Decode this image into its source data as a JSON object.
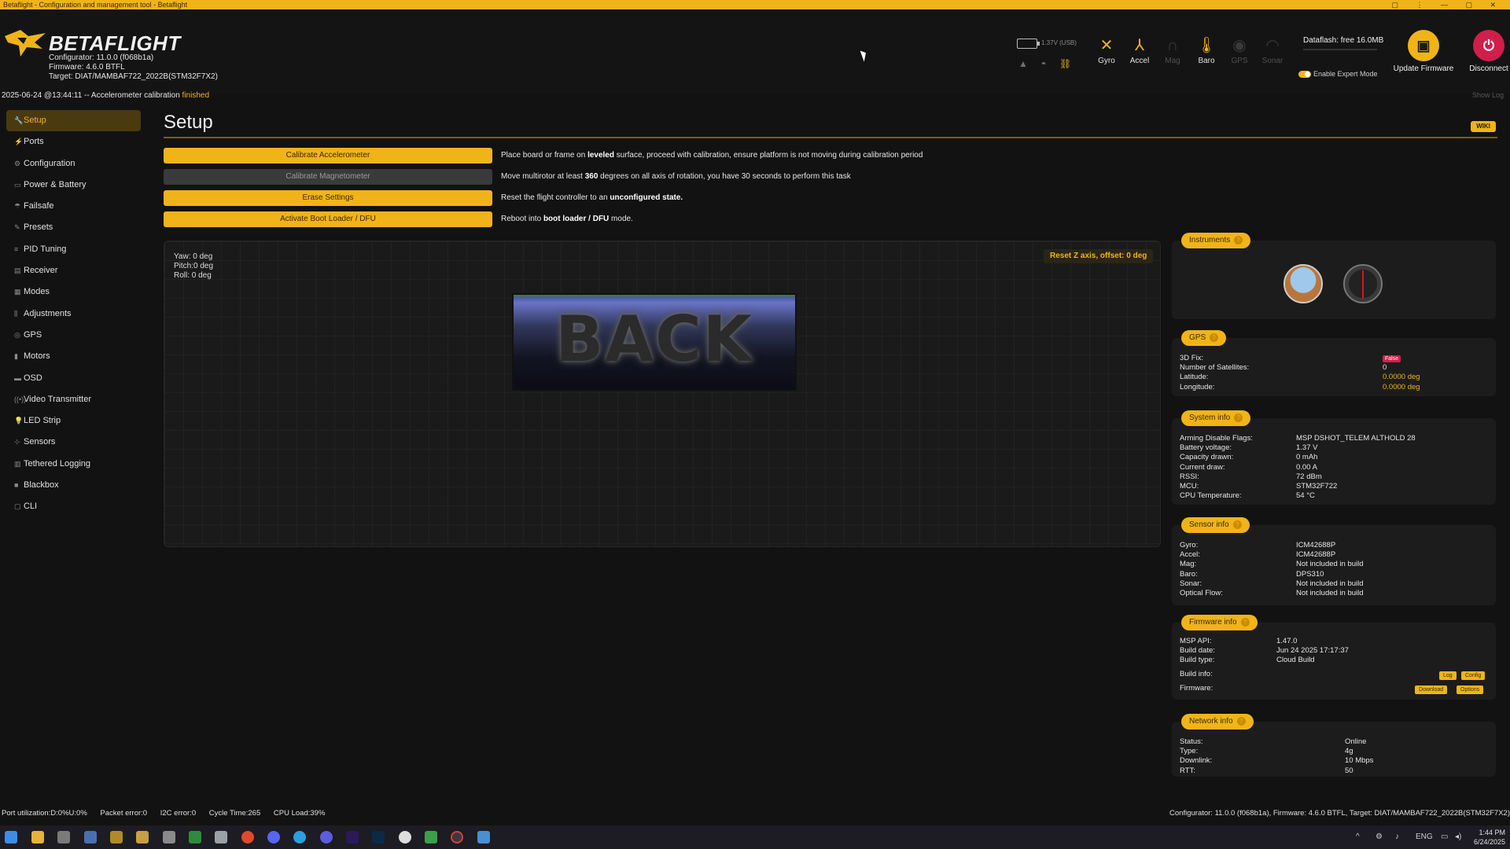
{
  "window": {
    "title": "Betaflight - Configuration and management tool - Betaflight"
  },
  "header": {
    "brand": "BETAFLIGHT",
    "configurator": "Configurator: 11.0.0 (f068b1a)",
    "firmware": "Firmware: 4.6.0 BTFL",
    "target": "Target: DIAT/MAMBAF722_2022B(STM32F7X2)",
    "log_prefix": "2025-06-24 @13:44:11 -- Accelerometer calibration",
    "log_status": "finished",
    "battery": "1.37V (USB)",
    "sensors": [
      {
        "label": "Gyro",
        "active": true,
        "icon": "gyro-icon"
      },
      {
        "label": "Accel",
        "active": true,
        "icon": "accel-icon"
      },
      {
        "label": "Mag",
        "active": false,
        "icon": "mag-icon"
      },
      {
        "label": "Baro",
        "active": true,
        "icon": "baro-icon"
      },
      {
        "label": "GPS",
        "active": false,
        "icon": "gps-icon"
      },
      {
        "label": "Sonar",
        "active": false,
        "icon": "sonar-icon"
      }
    ],
    "dataflash": "Dataflash: free 16.0MB",
    "expert_mode": "Enable Expert Mode",
    "update_firmware": "Update Firmware",
    "disconnect": "Disconnect",
    "show_log": "Show Log"
  },
  "sidebar": {
    "items": [
      {
        "label": "Setup",
        "icon": "wrench-icon"
      },
      {
        "label": "Ports",
        "icon": "plug-icon"
      },
      {
        "label": "Configuration",
        "icon": "gear-icon"
      },
      {
        "label": "Power & Battery",
        "icon": "battery-icon"
      },
      {
        "label": "Failsafe",
        "icon": "failsafe-icon"
      },
      {
        "label": "Presets",
        "icon": "presets-icon"
      },
      {
        "label": "PID Tuning",
        "icon": "pid-icon"
      },
      {
        "label": "Receiver",
        "icon": "receiver-icon"
      },
      {
        "label": "Modes",
        "icon": "modes-icon"
      },
      {
        "label": "Adjustments",
        "icon": "adjustments-icon"
      },
      {
        "label": "GPS",
        "icon": "gps-icon"
      },
      {
        "label": "Motors",
        "icon": "motor-icon"
      },
      {
        "label": "OSD",
        "icon": "osd-icon"
      },
      {
        "label": "Video Transmitter",
        "icon": "vtx-icon"
      },
      {
        "label": "LED Strip",
        "icon": "led-icon"
      },
      {
        "label": "Sensors",
        "icon": "sensors-icon"
      },
      {
        "label": "Tethered Logging",
        "icon": "tethered-icon"
      },
      {
        "label": "Blackbox",
        "icon": "blackbox-icon"
      },
      {
        "label": "CLI",
        "icon": "cli-icon"
      }
    ]
  },
  "setup": {
    "title": "Setup",
    "wiki": "WIKI",
    "actions": [
      {
        "button": "Calibrate Accelerometer",
        "desc_parts": [
          "Place board or frame on ",
          "leveled",
          " surface, proceed with calibration, ensure platform is not moving during calibration period"
        ]
      },
      {
        "button": "Calibrate Magnetometer",
        "desc_parts": [
          "Move multirotor at least ",
          "360",
          " degrees on all axis of rotation, you have 30 seconds to perform this task"
        ]
      },
      {
        "button": "Erase Settings",
        "desc_parts": [
          "Reset the flight controller to an ",
          "unconfigured state.",
          ""
        ]
      },
      {
        "button": "Activate Boot Loader / DFU",
        "desc_parts": [
          "Reboot into ",
          "boot loader / DFU",
          " mode."
        ]
      }
    ],
    "attitude": {
      "yaw": "Yaw: 0 deg",
      "pitch": "Pitch:0 deg",
      "roll": "Roll:  0 deg"
    },
    "reset_z": "Reset Z axis, offset: 0 deg",
    "model_text": "BACK"
  },
  "instruments": {
    "title": "Instruments"
  },
  "gps": {
    "title": "GPS",
    "rows": [
      {
        "k": "3D Fix:",
        "v": "False"
      },
      {
        "k": "Number of Satellites:",
        "v": "0"
      },
      {
        "k": "Latitude:",
        "v": "0.0000 deg"
      },
      {
        "k": "Longitude:",
        "v": "0.0000 deg"
      }
    ]
  },
  "system": {
    "title": "System info",
    "rows": [
      {
        "k": "Arming Disable Flags:",
        "v": "MSP  DSHOT_TELEM  ALTHOLD  28"
      },
      {
        "k": "Battery voltage:",
        "v": "1.37 V"
      },
      {
        "k": "Capacity drawn:",
        "v": "0 mAh"
      },
      {
        "k": "Current draw:",
        "v": "0.00 A"
      },
      {
        "k": "RSSI:",
        "v": "72 dBm"
      },
      {
        "k": "MCU:",
        "v": "STM32F722"
      },
      {
        "k": "CPU Temperature:",
        "v": "54 °C"
      }
    ]
  },
  "sensor": {
    "title": "Sensor info",
    "rows": [
      {
        "k": "Gyro:",
        "v": "ICM42688P"
      },
      {
        "k": "Accel:",
        "v": "ICM42688P"
      },
      {
        "k": "Mag:",
        "v": "Not included in build"
      },
      {
        "k": "Baro:",
        "v": "DPS310"
      },
      {
        "k": "Sonar:",
        "v": "Not included in build"
      },
      {
        "k": "Optical Flow:",
        "v": "Not included in build"
      }
    ]
  },
  "firmware": {
    "title": "Firmware info",
    "rows": [
      {
        "k": "MSP API:",
        "v": "1.47.0"
      },
      {
        "k": "Build date:",
        "v": "Jun 24 2025 17:17:37"
      },
      {
        "k": "Build type:",
        "v": "Cloud Build"
      }
    ],
    "build_info": "Build info:",
    "firmware_label": "Firmware:",
    "btn_log": "Log",
    "btn_config": "Config",
    "btn_download": "Download",
    "btn_options": "Options"
  },
  "network": {
    "title": "Network info",
    "rows": [
      {
        "k": "Status:",
        "v": "Online"
      },
      {
        "k": "Type:",
        "v": "4g"
      },
      {
        "k": "Downlink:",
        "v": "10 Mbps"
      },
      {
        "k": "RTT:",
        "v": "50"
      }
    ]
  },
  "footer": {
    "port_util": "Port utilization:D:0%U:0%",
    "packet_error": "Packet error:0",
    "i2c_error": "I2C error:0",
    "cycle_time": "Cycle Time:265",
    "cpu_load": "CPU Load:39%",
    "right": "Configurator: 11.0.0 (f068b1a), Firmware: 4.6.0 BTFL, Target: DIAT/MAMBAF722_2022B(STM32F7X2)"
  },
  "taskbar": {
    "lang": "ENG",
    "time": "1:44 PM",
    "date": "6/24/2025"
  },
  "colors": {
    "accent": "#f0b418",
    "background": "#121212",
    "badge_red": "#d21e4a"
  }
}
